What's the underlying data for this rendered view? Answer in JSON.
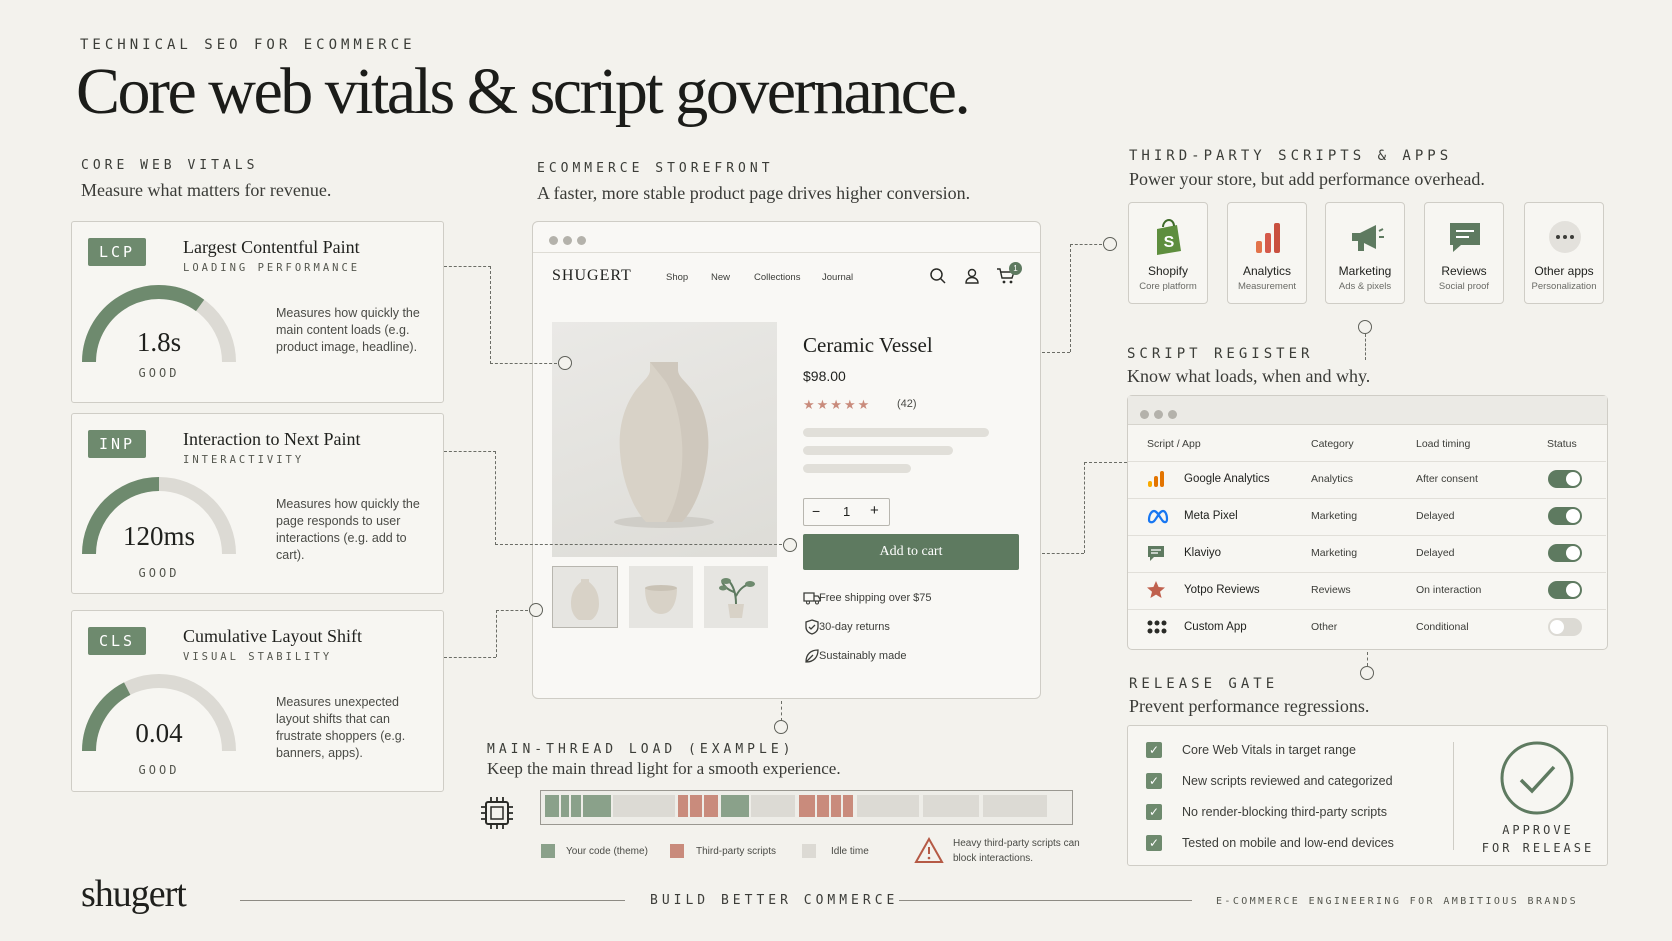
{
  "header": {
    "eyebrow": "TECHNICAL SEO FOR ECOMMERCE",
    "title": "Core web vitals & script governance."
  },
  "vitals": {
    "eyebrow": "CORE WEB VITALS",
    "subtitle": "Measure what matters for revenue.",
    "items": [
      {
        "tag": "LCP",
        "title": "Largest Contentful Paint",
        "sub": "LOADING PERFORMANCE",
        "value": "1.8s",
        "status": "GOOD",
        "level": 0.7,
        "desc": "Measures how quickly the main content loads (e.g. product image, headline)."
      },
      {
        "tag": "INP",
        "title": "Interaction to Next Paint",
        "sub": "INTERACTIVITY",
        "value": "120ms",
        "status": "GOOD",
        "level": 0.5,
        "desc": "Measures how quickly the page responds to user interactions (e.g. add to cart)."
      },
      {
        "tag": "CLS",
        "title": "Cumulative Layout Shift",
        "sub": "VISUAL STABILITY",
        "value": "0.04",
        "status": "GOOD",
        "level": 0.35,
        "desc": "Measures unexpected layout shifts that can frustrate shoppers (e.g. banners, apps)."
      }
    ]
  },
  "storefront": {
    "eyebrow": "ECOMMERCE STOREFRONT",
    "subtitle": "A faster, more stable product page drives higher conversion.",
    "brand": "SHUGERT",
    "nav": [
      "Shop",
      "New",
      "Collections",
      "Journal"
    ],
    "cart_count": "1",
    "product": {
      "name": "Ceramic Vessel",
      "price": "$98.00",
      "stars": "★★★★★",
      "reviews": "(42)",
      "qty": "1",
      "minus": "−",
      "plus": "+",
      "cta": "Add to cart",
      "features": [
        "Free shipping over $75",
        "30-day returns",
        "Sustainably made"
      ]
    }
  },
  "thread": {
    "eyebrow": "MAIN-THREAD LOAD (EXAMPLE)",
    "subtitle": "Keep the main thread light for a smooth experience.",
    "legend": [
      "Your code (theme)",
      "Third-party scripts",
      "Idle time"
    ],
    "warning": "Heavy third-party scripts can block interactions.",
    "colors": {
      "code": "#8aa18a",
      "third": "#c98b7c",
      "idle": "#dcdad4"
    }
  },
  "third_party": {
    "eyebrow": "THIRD-PARTY SCRIPTS & APPS",
    "subtitle": "Power your store, but add performance overhead.",
    "apps": [
      {
        "name": "Shopify",
        "desc": "Core platform",
        "icon": "shopify-icon"
      },
      {
        "name": "Analytics",
        "desc": "Measurement",
        "icon": "bar-chart-icon"
      },
      {
        "name": "Marketing",
        "desc": "Ads & pixels",
        "icon": "megaphone-icon"
      },
      {
        "name": "Reviews",
        "desc": "Social proof",
        "icon": "chat-bubble-icon"
      },
      {
        "name": "Other apps",
        "desc": "Personalization",
        "icon": "more-icon"
      }
    ]
  },
  "register": {
    "eyebrow": "SCRIPT REGISTER",
    "subtitle": "Know what loads, when and why.",
    "headers": [
      "Script / App",
      "Category",
      "Load timing",
      "Status"
    ],
    "rows": [
      {
        "name": "Google Analytics",
        "category": "Analytics",
        "timing": "After consent",
        "enabled": true,
        "icon": "google-analytics-icon"
      },
      {
        "name": "Meta Pixel",
        "category": "Marketing",
        "timing": "Delayed",
        "enabled": true,
        "icon": "meta-icon"
      },
      {
        "name": "Klaviyo",
        "category": "Marketing",
        "timing": "Delayed",
        "enabled": true,
        "icon": "chat-bubble-icon"
      },
      {
        "name": "Yotpo Reviews",
        "category": "Reviews",
        "timing": "On interaction",
        "enabled": true,
        "icon": "star-icon"
      },
      {
        "name": "Custom App",
        "category": "Other",
        "timing": "Conditional",
        "enabled": false,
        "icon": "grid-dots-icon"
      }
    ]
  },
  "gate": {
    "eyebrow": "RELEASE GATE",
    "subtitle": "Prevent performance regressions.",
    "items": [
      "Core Web Vitals in target range",
      "New scripts reviewed and categorized",
      "No render-blocking third-party scripts",
      "Tested on mobile and low-end devices"
    ],
    "approve_line1": "APPROVE",
    "approve_line2": "FOR RELEASE"
  },
  "footer": {
    "logo": "shugert",
    "tagline": "BUILD BETTER COMMERCE",
    "right": "E-COMMERCE ENGINEERING FOR AMBITIOUS BRANDS"
  }
}
